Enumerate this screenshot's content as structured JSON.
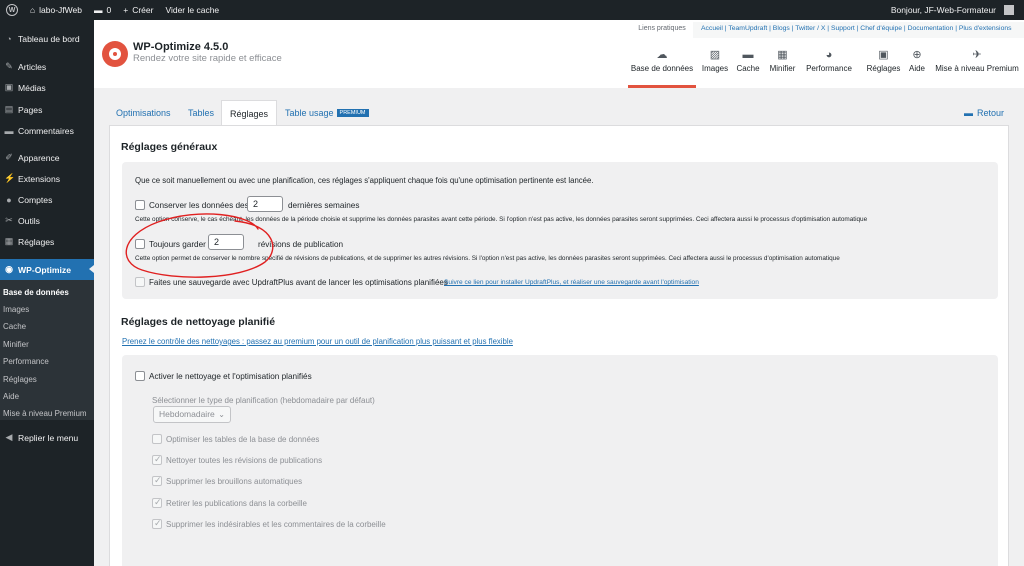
{
  "admin_bar": {
    "site_name": "labo-JfWeb",
    "comments_count": "0",
    "create_label": "Créer",
    "clear_cache_label": "Vider le cache",
    "greeting": "Bonjour, JF-Web-Formateur"
  },
  "sidebar": {
    "items": [
      {
        "label": "Tableau de bord",
        "icon": "dashboard-icon",
        "glyph": "◔"
      },
      {
        "label": "Articles",
        "icon": "pin-icon",
        "glyph": "✎"
      },
      {
        "label": "Médias",
        "icon": "media-icon",
        "glyph": "▣"
      },
      {
        "label": "Pages",
        "icon": "pages-icon",
        "glyph": "▤"
      },
      {
        "label": "Commentaires",
        "icon": "comments-icon",
        "glyph": "▬"
      },
      {
        "label": "Apparence",
        "icon": "brush-icon",
        "glyph": "✐"
      },
      {
        "label": "Extensions",
        "icon": "plugin-icon",
        "glyph": "⚡"
      },
      {
        "label": "Comptes",
        "icon": "users-icon",
        "glyph": "●"
      },
      {
        "label": "Outils",
        "icon": "tools-icon",
        "glyph": "✂"
      },
      {
        "label": "Réglages",
        "icon": "settings-icon",
        "glyph": "▦"
      },
      {
        "label": "WP-Optimize",
        "icon": "wpo-icon",
        "glyph": "◉"
      }
    ],
    "submenu": [
      "Base de données",
      "Images",
      "Cache",
      "Minifier",
      "Performance",
      "Réglages",
      "Aide",
      "Mise à niveau Premium"
    ],
    "collapse_label": "Replier le menu"
  },
  "header": {
    "title": "WP-Optimize 4.5.0",
    "tagline": "Rendez votre site rapide et efficace",
    "liens_label": "Liens pratiques",
    "links": "Accueil | TeamUpdraft | Blogs | Twitter / X | Support | Chef d'équipe | Documentation | Plus d'extensions",
    "nav": [
      {
        "label": "Base de données",
        "glyph": "☁"
      },
      {
        "label": "Images",
        "glyph": "▨"
      },
      {
        "label": "Cache",
        "glyph": "▬"
      },
      {
        "label": "Minifier",
        "glyph": "▦"
      },
      {
        "label": "Performance",
        "glyph": "◕"
      },
      {
        "label": "Réglages",
        "glyph": "▣"
      },
      {
        "label": "Aide",
        "glyph": "⊕"
      },
      {
        "label": "Mise à niveau Premium",
        "glyph": "✈"
      }
    ]
  },
  "tabs": {
    "items": [
      "Optimisations",
      "Tables",
      "Réglages",
      "Table usage"
    ],
    "premium_badge": "PREMIUM",
    "back_label": "Retour"
  },
  "general": {
    "title": "Réglages généraux",
    "intro": "Que ce soit manuellement ou avec une planification, ces réglages s'appliquent chaque fois qu'une optimisation pertinente est lancée.",
    "keep_before": "Conserver les données des",
    "keep_value": "2",
    "keep_after": "dernières semaines",
    "keep_desc": "Cette option conserve, le cas échéant, les données de la période choisie et supprime les données parasites avant cette période. Si l'option n'est pas active, les données parasites seront supprimées. Ceci affectera aussi le processus d'optimisation automatique",
    "always_before": "Toujours garder",
    "always_value": "2",
    "always_after": "révisions de publication",
    "always_desc": "Cette option permet de conserver le nombre spécifié de révisions de publications, et de supprimer les autres révisions. Si l'option n'est pas active, les données parasites seront supprimées. Ceci affectera aussi le processus d'optimisation automatique",
    "backup_label": "Faites une sauvegarde avec UpdraftPlus avant de lancer les optimisations planifiées",
    "backup_link": "Suivre ce lien pour installer UpdraftPlus, et réaliser une sauvegarde avant l'optimisation"
  },
  "scheduled": {
    "title": "Réglages de nettoyage planifié",
    "premium_link": "Prenez le contrôle des nettoyages : passez au premium pour un outil de planification plus puissant et plus flexible",
    "enable_label": "Activer le nettoyage et l'optimisation planifiés",
    "type_label": "Sélectionner le type de planification (hebdomadaire par défaut)",
    "type_value": "Hebdomadaire",
    "options": [
      {
        "label": "Optimiser les tables de la base de données",
        "checked": false
      },
      {
        "label": "Nettoyer toutes les révisions de publications",
        "checked": true
      },
      {
        "label": "Supprimer les brouillons automatiques",
        "checked": true
      },
      {
        "label": "Retirer les publications dans la corbeille",
        "checked": true
      },
      {
        "label": "Supprimer les indésirables et les commentaires de la corbeille",
        "checked": true
      }
    ]
  },
  "colors": {
    "wp_blue": "#2271b1",
    "admin_dark": "#1d2327",
    "wpo_accent": "#e2533f",
    "annotation": "#e02020"
  }
}
